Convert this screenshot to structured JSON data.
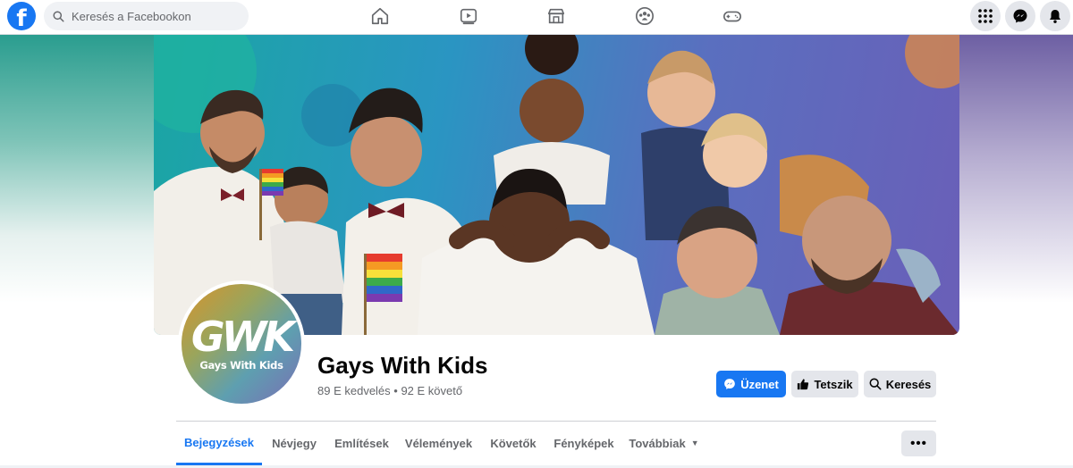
{
  "topbar": {
    "logo_letter": "f",
    "search_placeholder": "Keresés a Facebookon",
    "nav_icons": [
      "home-icon",
      "watch-icon",
      "marketplace-icon",
      "groups-icon",
      "gaming-icon"
    ],
    "right_icons": [
      "menu-grid-icon",
      "messenger-icon",
      "notifications-icon"
    ]
  },
  "cover": {
    "description_colors": {
      "teal": "#1aa6a3",
      "purple": "#6a5fb8"
    }
  },
  "profile": {
    "avatar_logo": "GWK",
    "avatar_subtitle": "Gays With Kids",
    "name": "Gays With Kids",
    "stats": "89 E kedvelés • 92 E követő"
  },
  "actions": {
    "message_label": "Üzenet",
    "like_label": "Tetszik",
    "search_label": "Keresés"
  },
  "tabs": [
    {
      "label": "Bejegyzések",
      "active": true
    },
    {
      "label": "Névjegy",
      "active": false
    },
    {
      "label": "Említések",
      "active": false
    },
    {
      "label": "Vélemények",
      "active": false
    },
    {
      "label": "Követők",
      "active": false
    },
    {
      "label": "Fényképek",
      "active": false
    },
    {
      "label": "Továbbiak",
      "active": false
    }
  ],
  "more_button_label": "•••",
  "colors": {
    "brand": "#1877f2",
    "secondary_button": "#e4e6eb",
    "muted_text": "#65676b"
  }
}
